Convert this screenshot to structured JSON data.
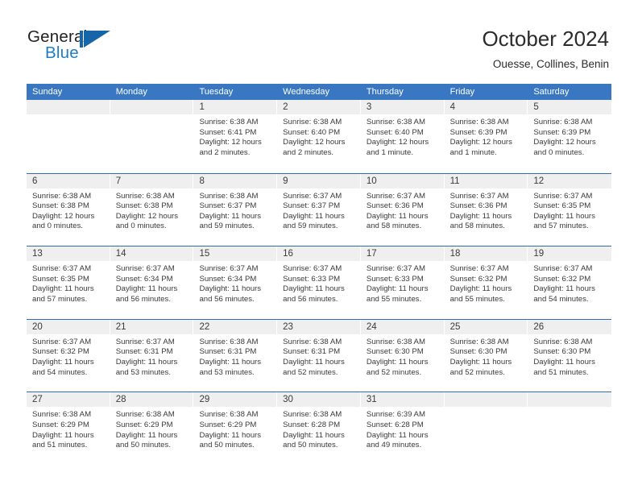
{
  "brand": {
    "word_one": "General",
    "word_two": "Blue",
    "mark": "triangle-logo-icon",
    "color_dark": "#231f20",
    "color_blue": "#1d7cc4"
  },
  "header": {
    "title": "October 2024",
    "location": "Ouesse, Collines, Benin"
  },
  "theme": {
    "header_blue": "#3a77c2",
    "row_divider_blue": "#2f6cb5",
    "day_band_gray": "#efefef",
    "text": "#3a3a3a"
  },
  "weekday_headers": [
    "Sunday",
    "Monday",
    "Tuesday",
    "Wednesday",
    "Thursday",
    "Friday",
    "Saturday"
  ],
  "weeks": [
    [
      {
        "day": "",
        "sunrise": "",
        "sunset": "",
        "daylight_line1": "",
        "daylight_line2": ""
      },
      {
        "day": "",
        "sunrise": "",
        "sunset": "",
        "daylight_line1": "",
        "daylight_line2": ""
      },
      {
        "day": "1",
        "sunrise": "Sunrise: 6:38 AM",
        "sunset": "Sunset: 6:41 PM",
        "daylight_line1": "Daylight: 12 hours",
        "daylight_line2": "and 2 minutes."
      },
      {
        "day": "2",
        "sunrise": "Sunrise: 6:38 AM",
        "sunset": "Sunset: 6:40 PM",
        "daylight_line1": "Daylight: 12 hours",
        "daylight_line2": "and 2 minutes."
      },
      {
        "day": "3",
        "sunrise": "Sunrise: 6:38 AM",
        "sunset": "Sunset: 6:40 PM",
        "daylight_line1": "Daylight: 12 hours",
        "daylight_line2": "and 1 minute."
      },
      {
        "day": "4",
        "sunrise": "Sunrise: 6:38 AM",
        "sunset": "Sunset: 6:39 PM",
        "daylight_line1": "Daylight: 12 hours",
        "daylight_line2": "and 1 minute."
      },
      {
        "day": "5",
        "sunrise": "Sunrise: 6:38 AM",
        "sunset": "Sunset: 6:39 PM",
        "daylight_line1": "Daylight: 12 hours",
        "daylight_line2": "and 0 minutes."
      }
    ],
    [
      {
        "day": "6",
        "sunrise": "Sunrise: 6:38 AM",
        "sunset": "Sunset: 6:38 PM",
        "daylight_line1": "Daylight: 12 hours",
        "daylight_line2": "and 0 minutes."
      },
      {
        "day": "7",
        "sunrise": "Sunrise: 6:38 AM",
        "sunset": "Sunset: 6:38 PM",
        "daylight_line1": "Daylight: 12 hours",
        "daylight_line2": "and 0 minutes."
      },
      {
        "day": "8",
        "sunrise": "Sunrise: 6:38 AM",
        "sunset": "Sunset: 6:37 PM",
        "daylight_line1": "Daylight: 11 hours",
        "daylight_line2": "and 59 minutes."
      },
      {
        "day": "9",
        "sunrise": "Sunrise: 6:37 AM",
        "sunset": "Sunset: 6:37 PM",
        "daylight_line1": "Daylight: 11 hours",
        "daylight_line2": "and 59 minutes."
      },
      {
        "day": "10",
        "sunrise": "Sunrise: 6:37 AM",
        "sunset": "Sunset: 6:36 PM",
        "daylight_line1": "Daylight: 11 hours",
        "daylight_line2": "and 58 minutes."
      },
      {
        "day": "11",
        "sunrise": "Sunrise: 6:37 AM",
        "sunset": "Sunset: 6:36 PM",
        "daylight_line1": "Daylight: 11 hours",
        "daylight_line2": "and 58 minutes."
      },
      {
        "day": "12",
        "sunrise": "Sunrise: 6:37 AM",
        "sunset": "Sunset: 6:35 PM",
        "daylight_line1": "Daylight: 11 hours",
        "daylight_line2": "and 57 minutes."
      }
    ],
    [
      {
        "day": "13",
        "sunrise": "Sunrise: 6:37 AM",
        "sunset": "Sunset: 6:35 PM",
        "daylight_line1": "Daylight: 11 hours",
        "daylight_line2": "and 57 minutes."
      },
      {
        "day": "14",
        "sunrise": "Sunrise: 6:37 AM",
        "sunset": "Sunset: 6:34 PM",
        "daylight_line1": "Daylight: 11 hours",
        "daylight_line2": "and 56 minutes."
      },
      {
        "day": "15",
        "sunrise": "Sunrise: 6:37 AM",
        "sunset": "Sunset: 6:34 PM",
        "daylight_line1": "Daylight: 11 hours",
        "daylight_line2": "and 56 minutes."
      },
      {
        "day": "16",
        "sunrise": "Sunrise: 6:37 AM",
        "sunset": "Sunset: 6:33 PM",
        "daylight_line1": "Daylight: 11 hours",
        "daylight_line2": "and 56 minutes."
      },
      {
        "day": "17",
        "sunrise": "Sunrise: 6:37 AM",
        "sunset": "Sunset: 6:33 PM",
        "daylight_line1": "Daylight: 11 hours",
        "daylight_line2": "and 55 minutes."
      },
      {
        "day": "18",
        "sunrise": "Sunrise: 6:37 AM",
        "sunset": "Sunset: 6:32 PM",
        "daylight_line1": "Daylight: 11 hours",
        "daylight_line2": "and 55 minutes."
      },
      {
        "day": "19",
        "sunrise": "Sunrise: 6:37 AM",
        "sunset": "Sunset: 6:32 PM",
        "daylight_line1": "Daylight: 11 hours",
        "daylight_line2": "and 54 minutes."
      }
    ],
    [
      {
        "day": "20",
        "sunrise": "Sunrise: 6:37 AM",
        "sunset": "Sunset: 6:32 PM",
        "daylight_line1": "Daylight: 11 hours",
        "daylight_line2": "and 54 minutes."
      },
      {
        "day": "21",
        "sunrise": "Sunrise: 6:37 AM",
        "sunset": "Sunset: 6:31 PM",
        "daylight_line1": "Daylight: 11 hours",
        "daylight_line2": "and 53 minutes."
      },
      {
        "day": "22",
        "sunrise": "Sunrise: 6:38 AM",
        "sunset": "Sunset: 6:31 PM",
        "daylight_line1": "Daylight: 11 hours",
        "daylight_line2": "and 53 minutes."
      },
      {
        "day": "23",
        "sunrise": "Sunrise: 6:38 AM",
        "sunset": "Sunset: 6:31 PM",
        "daylight_line1": "Daylight: 11 hours",
        "daylight_line2": "and 52 minutes."
      },
      {
        "day": "24",
        "sunrise": "Sunrise: 6:38 AM",
        "sunset": "Sunset: 6:30 PM",
        "daylight_line1": "Daylight: 11 hours",
        "daylight_line2": "and 52 minutes."
      },
      {
        "day": "25",
        "sunrise": "Sunrise: 6:38 AM",
        "sunset": "Sunset: 6:30 PM",
        "daylight_line1": "Daylight: 11 hours",
        "daylight_line2": "and 52 minutes."
      },
      {
        "day": "26",
        "sunrise": "Sunrise: 6:38 AM",
        "sunset": "Sunset: 6:30 PM",
        "daylight_line1": "Daylight: 11 hours",
        "daylight_line2": "and 51 minutes."
      }
    ],
    [
      {
        "day": "27",
        "sunrise": "Sunrise: 6:38 AM",
        "sunset": "Sunset: 6:29 PM",
        "daylight_line1": "Daylight: 11 hours",
        "daylight_line2": "and 51 minutes."
      },
      {
        "day": "28",
        "sunrise": "Sunrise: 6:38 AM",
        "sunset": "Sunset: 6:29 PM",
        "daylight_line1": "Daylight: 11 hours",
        "daylight_line2": "and 50 minutes."
      },
      {
        "day": "29",
        "sunrise": "Sunrise: 6:38 AM",
        "sunset": "Sunset: 6:29 PM",
        "daylight_line1": "Daylight: 11 hours",
        "daylight_line2": "and 50 minutes."
      },
      {
        "day": "30",
        "sunrise": "Sunrise: 6:38 AM",
        "sunset": "Sunset: 6:28 PM",
        "daylight_line1": "Daylight: 11 hours",
        "daylight_line2": "and 50 minutes."
      },
      {
        "day": "31",
        "sunrise": "Sunrise: 6:39 AM",
        "sunset": "Sunset: 6:28 PM",
        "daylight_line1": "Daylight: 11 hours",
        "daylight_line2": "and 49 minutes."
      },
      {
        "day": "",
        "sunrise": "",
        "sunset": "",
        "daylight_line1": "",
        "daylight_line2": ""
      },
      {
        "day": "",
        "sunrise": "",
        "sunset": "",
        "daylight_line1": "",
        "daylight_line2": ""
      }
    ]
  ]
}
